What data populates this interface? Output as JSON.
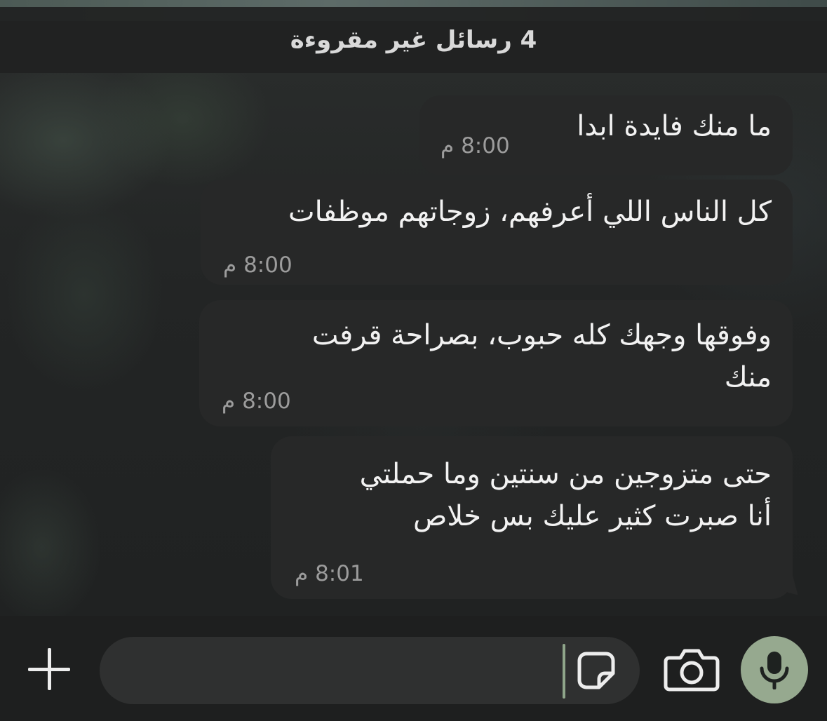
{
  "header": {
    "unread_label": "4 رسائل غير مقروءة"
  },
  "messages": [
    {
      "text": "ما منك فايدة ابدا",
      "time": "8:00 م"
    },
    {
      "text": "كل الناس اللي أعرفهم، زوجاتهم موظفات",
      "time": "8:00 م"
    },
    {
      "text": "وفوقها وجهك كله حبوب، بصراحة قرفت\nمنك",
      "time": "8:00 م"
    },
    {
      "text": "حتى متزوجين من سنتين وما حملتي\nأنا صبرت كثير عليك بس خلاص",
      "time": "8:01 م"
    }
  ],
  "composer": {
    "input_value": "",
    "icons": [
      "plus-icon",
      "sticker-icon",
      "camera-icon",
      "microphone-icon"
    ],
    "mic_color": "#96a98f"
  }
}
